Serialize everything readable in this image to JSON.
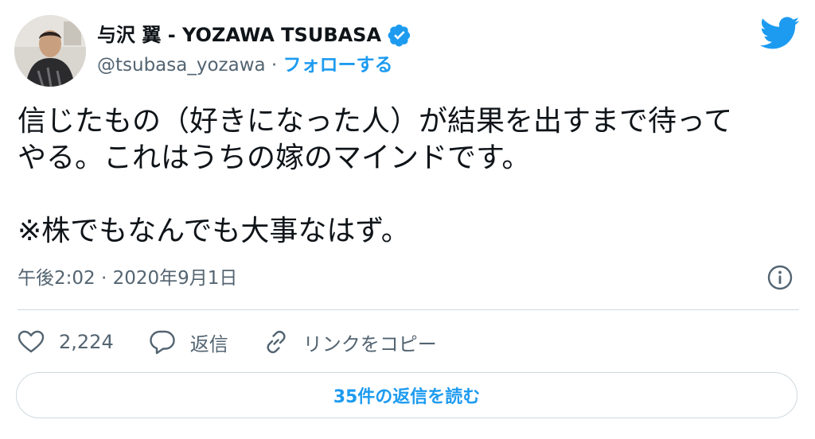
{
  "author": {
    "name": "与沢 翼 - YOZAWA TSUBASA",
    "handle": "@tsubasa_yozawa",
    "separator": "·",
    "follow_label": "フォローする"
  },
  "tweet": {
    "text": "信じたもの（好きになった人）が結果を出すまで待って\nやる。これはうちの嫁のマインドです。\n\n※株でもなんでも大事なはず。",
    "timestamp": "午後2:02 · 2020年9月1日"
  },
  "actions": {
    "likes_count": "2,224",
    "reply_label": "返信",
    "copy_link_label": "リンクをコピー"
  },
  "replies_button": {
    "label": "35件の返信を読む"
  },
  "colors": {
    "accent": "#1d9bf0",
    "text": "#0f1419",
    "muted": "#536471",
    "border": "#cfd9de"
  },
  "icons": [
    "avatar",
    "verified-badge-icon",
    "twitter-bird-icon",
    "info-icon",
    "heart-icon",
    "reply-icon",
    "link-icon"
  ]
}
